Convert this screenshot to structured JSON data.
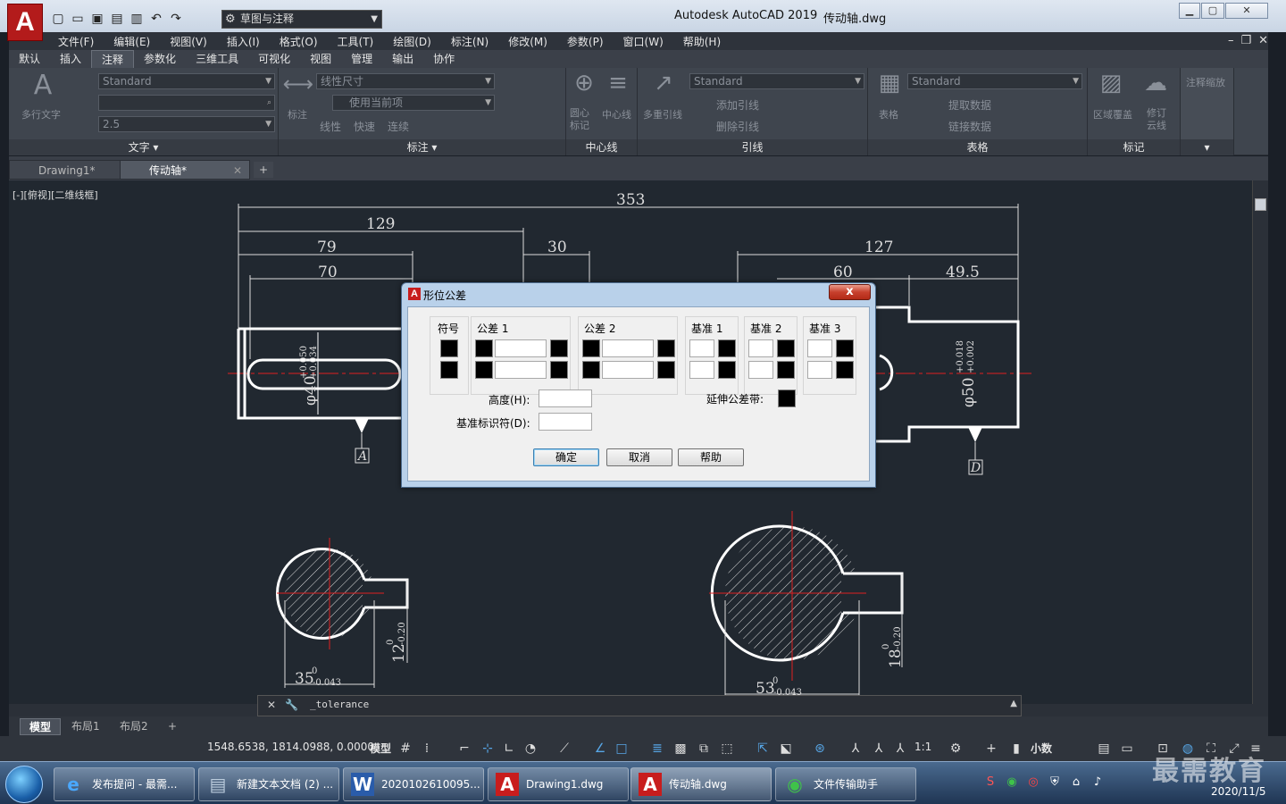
{
  "titlebar": {
    "app_title": "Autodesk AutoCAD 2019",
    "file_title": "传动轴.dwg",
    "workspace": "草图与注释",
    "logo": "A"
  },
  "menu": [
    "文件(F)",
    "编辑(E)",
    "视图(V)",
    "插入(I)",
    "格式(O)",
    "工具(T)",
    "绘图(D)",
    "标注(N)",
    "修改(M)",
    "参数(P)",
    "窗口(W)",
    "帮助(H)"
  ],
  "ribbon_tabs": [
    "默认",
    "插入",
    "注释",
    "参数化",
    "三维工具",
    "可视化",
    "视图",
    "管理",
    "输出",
    "协作"
  ],
  "ribbon_active_tab": "注释",
  "ribbon": {
    "text_panel": {
      "title": "文字",
      "big_button": "多行文字",
      "style_combo": "Standard",
      "height_combo": "2.5"
    },
    "dim_panel": {
      "title": "标注",
      "big_button": "标注",
      "style_combo": "线性尺寸",
      "layer_combo": "使用当前项",
      "row3": [
        "线性",
        "快速",
        "连续"
      ]
    },
    "centerline_panel": {
      "title": "中心线",
      "buttons": [
        "圆心标记",
        "中心线"
      ]
    },
    "leader_panel": {
      "title": "引线",
      "big_button": "多重引线",
      "style_combo": "Standard",
      "row2": "添加引线",
      "row3": "删除引线"
    },
    "table_panel": {
      "title": "表格",
      "big_button": "表格",
      "style_combo": "Standard",
      "row2": "提取数据",
      "row3": "链接数据"
    },
    "markup_panel": {
      "title": "标记",
      "buttons": [
        "区域覆盖",
        "修订云线"
      ]
    },
    "scale_panel": {
      "label": "注释缩放"
    }
  },
  "doc_tabs": [
    {
      "label": "Drawing1*",
      "active": false
    },
    {
      "label": "传动轴*",
      "active": true
    }
  ],
  "viewport_label": "[-][俯视][二维线框]",
  "drawing": {
    "dims": [
      "353",
      "129",
      "79",
      "70",
      "30",
      "127",
      "60",
      "49.5"
    ],
    "left_dia": {
      "base": "φ40",
      "upper": "+0.050",
      "lower": "+0.034"
    },
    "right_dia": {
      "base": "φ50",
      "upper": "+0.018",
      "lower": "+0.002"
    },
    "datum_a": "A",
    "datum_d": "D",
    "sec1": {
      "width": "35",
      "w_upper": "0",
      "w_lower": "-0.043",
      "depth": "12",
      "d_upper": "0",
      "d_lower": "-0.20"
    },
    "sec2": {
      "width": "53",
      "w_upper": "0",
      "w_lower": "-0.043",
      "depth": "18",
      "d_upper": "0",
      "d_lower": "-0.20"
    }
  },
  "dialog": {
    "title": "形位公差",
    "close": "x",
    "groups": [
      "符号",
      "公差 1",
      "公差 2",
      "基准 1",
      "基准 2",
      "基准 3"
    ],
    "height_label": "高度(H):",
    "datum_id_label": "基准标识符(D):",
    "projected_label": "延伸公差带:",
    "ok": "确定",
    "cancel": "取消",
    "help": "帮助"
  },
  "command_line": "_tolerance",
  "layout_tabs": [
    "模型",
    "布局1",
    "布局2"
  ],
  "status": {
    "coords": "1548.6538, 1814.0988, 0.0000",
    "model": "模型",
    "scale": "1:1",
    "units": "小数"
  },
  "taskbar": {
    "items": [
      "发布提问 - 最需...",
      "新建文本文档 (2) ...",
      "2020102610095...",
      "Drawing1.dwg",
      "传动轴.dwg",
      "文件传输助手"
    ],
    "date": "2020/11/5"
  },
  "watermark": "最需教育"
}
